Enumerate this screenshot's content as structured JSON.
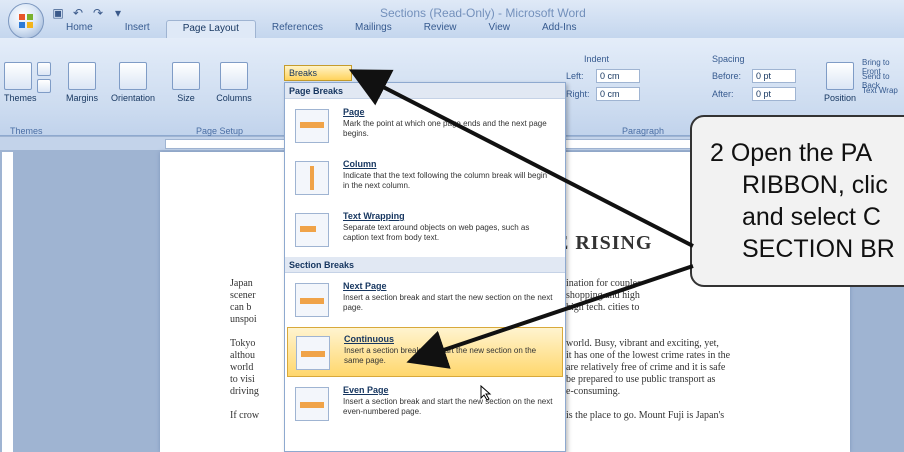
{
  "window": {
    "title": "Sections (Read-Only) - Microsoft Word"
  },
  "tabs": [
    "Home",
    "Insert",
    "Page Layout",
    "References",
    "Mailings",
    "Review",
    "View",
    "Add-Ins"
  ],
  "active_tab": "Page Layout",
  "ribbon": {
    "themes_label": "Themes",
    "margins_label": "Margins",
    "orientation_label": "Orientation",
    "size_label": "Size",
    "columns_label": "Columns",
    "breaks_label": "Breaks",
    "group_themes": "Themes",
    "group_page_setup": "Page Setup",
    "group_paragraph": "Paragraph",
    "indent_label": "Indent",
    "indent_left_label": "Left:",
    "indent_left_value": "0 cm",
    "indent_right_label": "Right:",
    "indent_right_value": "0 cm",
    "spacing_label": "Spacing",
    "spacing_before_label": "Before:",
    "spacing_before_value": "0 pt",
    "spacing_after_label": "After:",
    "spacing_after_value": "0 pt",
    "position_label": "Position",
    "bring_to_front": "Bring to Front",
    "send_to_back": "Send to Back",
    "text_wrapping": "Text Wrap"
  },
  "breaks_menu": {
    "page_breaks_header": "Page Breaks",
    "section_breaks_header": "Section Breaks",
    "items": [
      {
        "title": "Page",
        "desc": "Mark the point at which one page ends and the next page begins."
      },
      {
        "title": "Column",
        "desc": "Indicate that the text following the column break will begin in the next column."
      },
      {
        "title": "Text Wrapping",
        "desc": "Separate text around objects on web pages, such as caption text from body text."
      },
      {
        "title": "Next Page",
        "desc": "Insert a section break and start the new section on the next page."
      },
      {
        "title": "Continuous",
        "desc": "Insert a section break and start the new section on the same page."
      },
      {
        "title": "Even Page",
        "desc": "Insert a section break and start the new section on the next even-numbered page."
      }
    ],
    "highlighted_index": 4
  },
  "document": {
    "heading": "E RISING",
    "left_lines": [
      "Japan",
      "scener",
      "can b",
      "unspoi",
      "",
      "Tokyo",
      "althou",
      "world",
      "to visi",
      "driving",
      "",
      "If crow"
    ],
    "right_lines_a": [
      "ination for couples",
      "shopping and high",
      "high tech. cities to"
    ],
    "right_lines_b": [
      "world. Busy, vibrant and exciting, yet,",
      "it has one of the lowest crime rates in the",
      "are relatively free of crime and it is safe",
      "be prepared to use public transport as",
      "e-consuming.",
      "",
      "is the place to go. Mount Fuji is Japan's"
    ]
  },
  "callout": {
    "lines": [
      "2  Open the PA",
      "RIBBON, clic",
      "and select C",
      "SECTION BR"
    ]
  },
  "colors": {
    "accent": "#ffd35c",
    "highlight": "#ffd76d",
    "ribbon": "#dbe6f5"
  }
}
